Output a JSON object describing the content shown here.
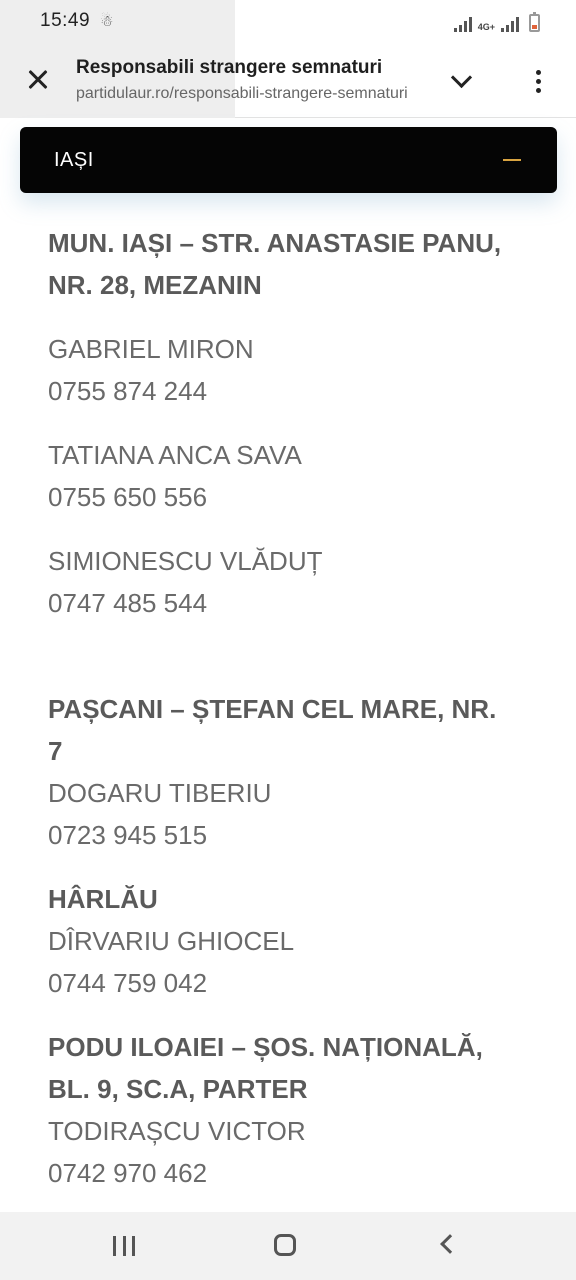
{
  "status_bar": {
    "time": "15:49",
    "notification_icon": "person-alert-icon",
    "network_label": "4G+"
  },
  "browser": {
    "page_title": "Responsabili strangere semnaturi",
    "url": "partidulaur.ro/responsabili-strangere-semnaturi"
  },
  "accordion": {
    "title": "IAȘI",
    "toggle_icon": "minus-icon",
    "toggle_color": "#d9a441"
  },
  "contacts": [
    {
      "address_lines": [
        "MUN. IAȘI – STR. ANASTASIE PANU,",
        "NR. 28, MEZANIN"
      ],
      "people": [
        {
          "name": "GABRIEL MIRON",
          "phone": "0755 874 244"
        },
        {
          "name": "TATIANA ANCA SAVA",
          "phone": "0755 650 556"
        },
        {
          "name": "SIMIONESCU VLĂDUȚ",
          "phone": "0747 485 544"
        }
      ]
    },
    {
      "address_lines": [
        "PAȘCANI – ȘTEFAN CEL MARE, NR.",
        "7"
      ],
      "people": [
        {
          "name": "DOGARU TIBERIU",
          "phone": "0723 945 515"
        }
      ]
    },
    {
      "address_lines": [
        "HÂRLĂU"
      ],
      "people": [
        {
          "name": "DÎRVARIU GHIOCEL",
          "phone": "0744 759 042"
        }
      ]
    },
    {
      "address_lines": [
        "PODU ILOAIEI – ȘOS. NAȚIONALĂ,",
        "BL. 9, SC.A, PARTER"
      ],
      "people": [
        {
          "name": "TODIRAȘCU VICTOR",
          "phone": "0742 970 462"
        }
      ]
    }
  ]
}
